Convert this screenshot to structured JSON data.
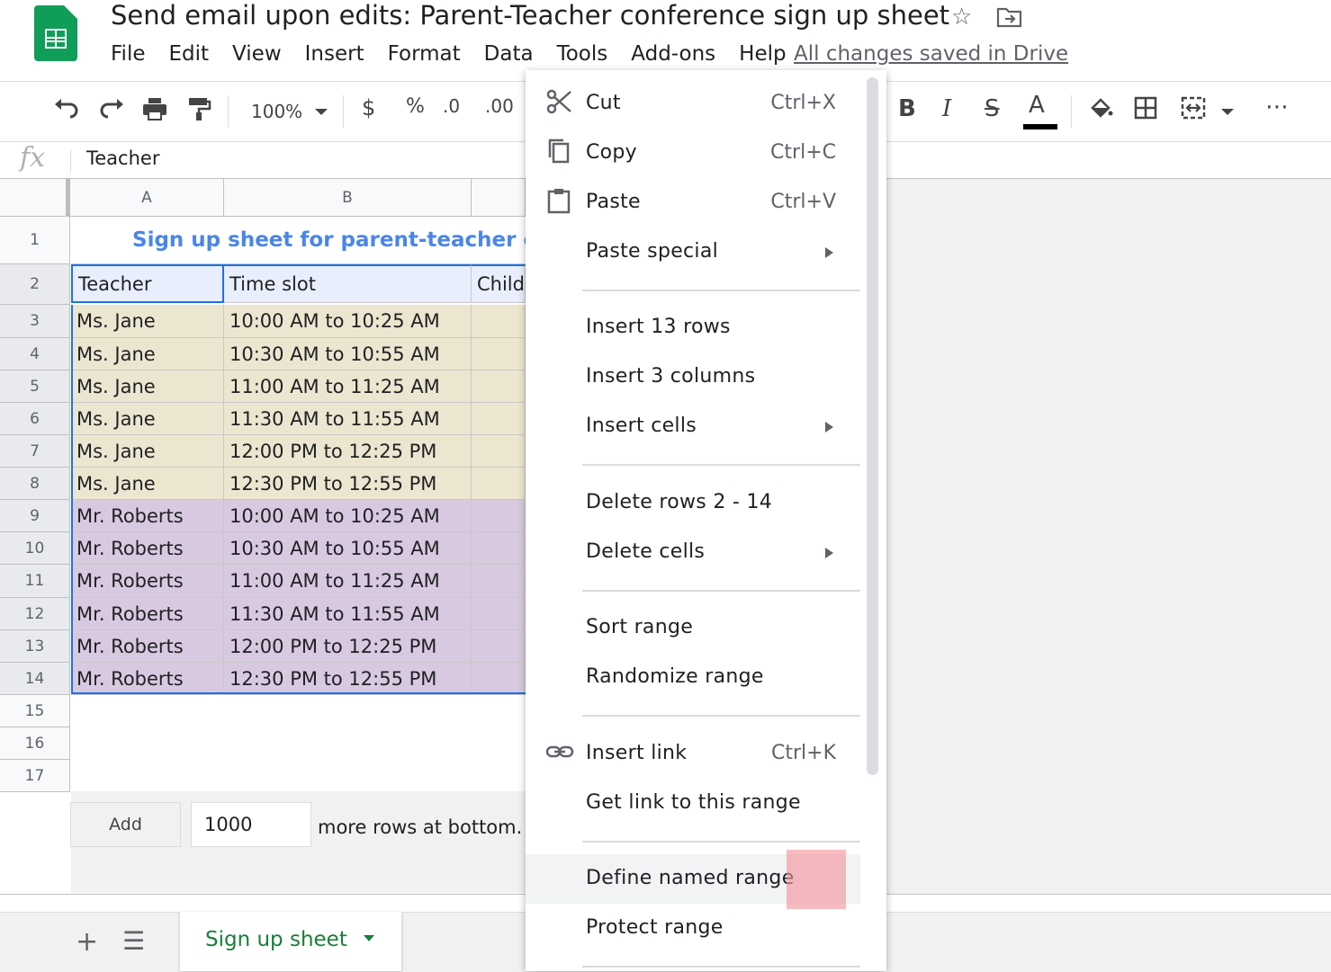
{
  "app": {
    "doc_title": "Send email upon edits: Parent-Teacher conference sign up sheet",
    "save_status": "All changes saved in Drive",
    "menu": [
      "File",
      "Edit",
      "View",
      "Insert",
      "Format",
      "Data",
      "Tools",
      "Add-ons",
      "Help"
    ]
  },
  "toolbar": {
    "zoom": "100%",
    "currency": "$",
    "percent": "%",
    "decrease_decimal": ".0",
    "increase_decimal": ".00",
    "bold": "B",
    "italic": "I",
    "strikethrough": "S",
    "text_color": "A",
    "more": "⋯"
  },
  "formula_bar": {
    "fx": "fx",
    "value": "Teacher"
  },
  "grid": {
    "columns": [
      "A",
      "B"
    ],
    "row_numbers": [
      "1",
      "2",
      "3",
      "4",
      "5",
      "6",
      "7",
      "8",
      "9",
      "10",
      "11",
      "12",
      "13",
      "14",
      "15",
      "16",
      "17"
    ],
    "title": "Sign up sheet for parent-teacher con",
    "headers": [
      "Teacher",
      "Time slot",
      "Child"
    ],
    "rows": [
      [
        "Ms. Jane",
        "10:00 AM to 10:25 AM"
      ],
      [
        "Ms. Jane",
        "10:30 AM to 10:55 AM"
      ],
      [
        "Ms. Jane",
        "11:00 AM to 11:25 AM"
      ],
      [
        "Ms. Jane",
        "11:30 AM to 11:55 AM"
      ],
      [
        "Ms. Jane",
        "12:00 PM to 12:25 PM"
      ],
      [
        "Ms. Jane",
        "12:30 PM to 12:55 PM"
      ],
      [
        "Mr. Roberts",
        "10:00 AM to 10:25 AM"
      ],
      [
        "Mr. Roberts",
        "10:30 AM to 10:55 AM"
      ],
      [
        "Mr. Roberts",
        "11:00 AM to 11:25 AM"
      ],
      [
        "Mr. Roberts",
        "11:30 AM to 11:55 AM"
      ],
      [
        "Mr. Roberts",
        "12:00 PM to 12:25 PM"
      ],
      [
        "Mr. Roberts",
        "12:30 PM to 12:55 PM"
      ]
    ],
    "colors": {
      "jane": "#ece6d0",
      "roberts": "#d9c9e0",
      "title": "#4a86e8"
    }
  },
  "add_rows": {
    "button": "Add",
    "value": "1000",
    "suffix": "more rows at bottom."
  },
  "sheet_tabs": {
    "active": "Sign up sheet"
  },
  "context_menu": {
    "items": [
      {
        "label": "Cut",
        "shortcut": "Ctrl+X",
        "icon": "scissors-icon"
      },
      {
        "label": "Copy",
        "shortcut": "Ctrl+C",
        "icon": "copy-icon"
      },
      {
        "label": "Paste",
        "shortcut": "Ctrl+V",
        "icon": "clipboard-icon"
      },
      {
        "label": "Paste special",
        "submenu": true
      },
      {
        "label": "Insert 13 rows"
      },
      {
        "label": "Insert 3 columns"
      },
      {
        "label": "Insert cells",
        "submenu": true
      },
      {
        "label": "Delete rows 2 - 14"
      },
      {
        "label": "Delete cells",
        "submenu": true
      },
      {
        "label": "Sort range"
      },
      {
        "label": "Randomize range"
      },
      {
        "label": "Insert link",
        "shortcut": "Ctrl+K",
        "icon": "link-icon"
      },
      {
        "label": "Get link to this range"
      },
      {
        "label": "Define named range",
        "highlighted": true
      },
      {
        "label": "Protect range"
      }
    ]
  }
}
